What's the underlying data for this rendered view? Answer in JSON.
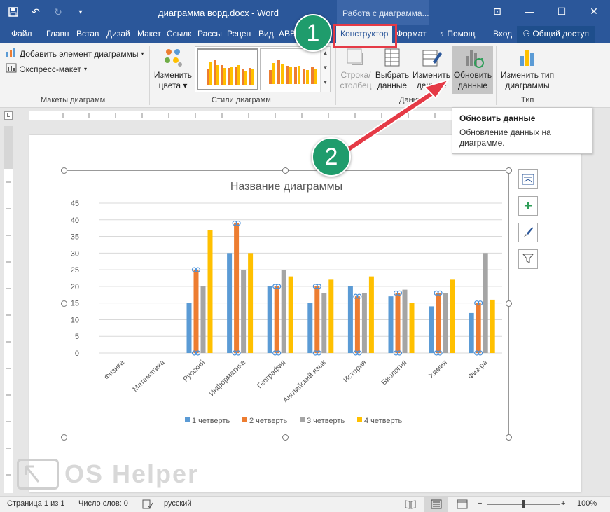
{
  "window": {
    "title": "диаграмма ворд.docx - Word",
    "context_tab_header": "Работа с диаграмма..."
  },
  "tabs": [
    "Файл",
    "Главн",
    "Встав",
    "Дизай",
    "Макет",
    "Ссылк",
    "Рассы",
    "Рецен",
    "Вид",
    "ABB",
    "Конструктор",
    "Формат",
    "Помощ",
    "Вход"
  ],
  "active_tab": "Конструктор",
  "share_label": "Общий доступ",
  "ribbon": {
    "add_element": "Добавить элемент диаграммы",
    "express_layout": "Экспресс-макет",
    "change_colors_1": "Изменить",
    "change_colors_2": "цвета",
    "row_col_1": "Строка/",
    "row_col_2": "столбец",
    "select_data_1": "Выбрать",
    "select_data_2": "данные",
    "edit_data_1": "Изменить",
    "edit_data_2": "данные",
    "refresh_data_1": "Обновить",
    "refresh_data_2": "данные",
    "change_type_1": "Изменить тип",
    "change_type_2": "диаграммы",
    "group_layouts": "Макеты диаграмм",
    "group_styles": "Стили диаграмм",
    "group_data": "Данные",
    "group_type": "Тип"
  },
  "tooltip": {
    "title": "Обновить данные",
    "body": "Обновление данных на диаграмме."
  },
  "callouts": [
    "1",
    "2"
  ],
  "status": {
    "page": "Страница 1 из 1",
    "words": "Число слов: 0",
    "language": "русский",
    "zoom": "100%"
  },
  "watermark": "OS Helper",
  "colors": {
    "q1": "#5b9bd5",
    "q2": "#ed7d31",
    "q3": "#a5a5a5",
    "q4": "#ffc000",
    "titlebar": "#2b579a",
    "callout": "#1f9c6c",
    "highlight_box": "#e53a46"
  },
  "chart_data": {
    "type": "bar",
    "title": "Название диаграммы",
    "categories": [
      "Физика",
      "Математика",
      "Русский",
      "Информатика",
      "География",
      "Английский язык",
      "История",
      "Биология",
      "Химия",
      "Физ-ра"
    ],
    "series": [
      {
        "name": "1 четверть",
        "values": [
          null,
          null,
          15,
          30,
          20,
          15,
          20,
          17,
          14,
          12
        ]
      },
      {
        "name": "2 четверть",
        "values": [
          null,
          null,
          25,
          39,
          20,
          20,
          17,
          18,
          18,
          15
        ]
      },
      {
        "name": "3 четверть",
        "values": [
          null,
          null,
          20,
          25,
          25,
          18,
          18,
          19,
          18,
          30
        ]
      },
      {
        "name": "4 четверть",
        "values": [
          null,
          null,
          37,
          30,
          23,
          22,
          23,
          15,
          22,
          16
        ]
      }
    ],
    "y_ticks": [
      0,
      5,
      10,
      15,
      20,
      25,
      30,
      35,
      40,
      45
    ],
    "ylim": [
      0,
      45
    ],
    "grid": true,
    "legend": "bottom"
  }
}
